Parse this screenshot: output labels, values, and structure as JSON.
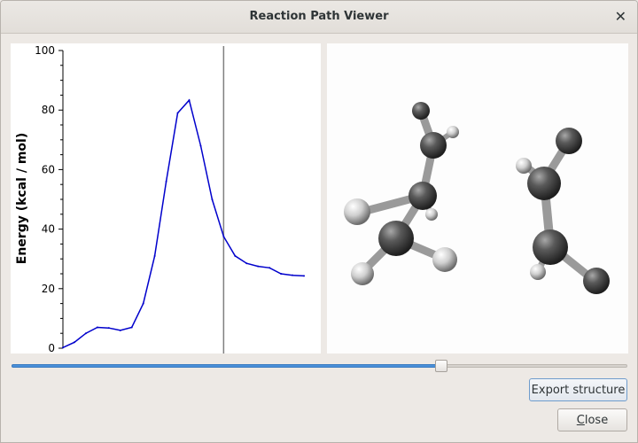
{
  "window": {
    "title": "Reaction Path Viewer"
  },
  "chart_data": {
    "type": "line",
    "ylabel": "Energy (kcal / mol)",
    "xlabel": "",
    "ylim": [
      0,
      100
    ],
    "xlim": [
      0,
      22
    ],
    "yticks": [
      0,
      20,
      40,
      60,
      80,
      100
    ],
    "grid": false,
    "series": [
      {
        "color": "#0000cc",
        "x": [
          0,
          1,
          2,
          3,
          4,
          5,
          6,
          7,
          8,
          9,
          10,
          11,
          12,
          13,
          14,
          15,
          16,
          17,
          18,
          19,
          20,
          21
        ],
        "values": [
          0.2,
          2,
          5,
          7,
          6.8,
          6,
          7,
          15,
          31,
          56,
          79,
          83.3,
          68,
          50,
          37.5,
          31,
          28.5,
          27.5,
          27,
          25,
          24.5,
          24.3
        ]
      }
    ],
    "cursor_x": 14
  },
  "slider": {
    "value": 0.7
  },
  "buttons": {
    "export_label": "Export structure",
    "close_accel": "C",
    "close_rest": "lose"
  },
  "icons": {
    "close": "close-icon"
  }
}
